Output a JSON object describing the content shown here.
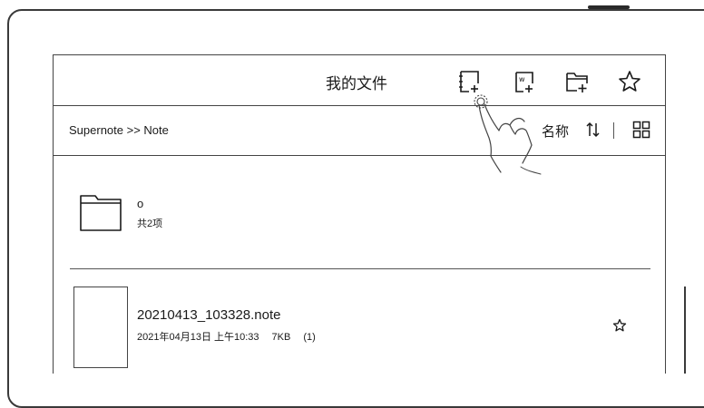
{
  "header": {
    "title": "我的文件",
    "actions": [
      {
        "name": "new-note",
        "icon": "new-note-icon"
      },
      {
        "name": "new-document",
        "icon": "new-document-icon"
      },
      {
        "name": "new-folder",
        "icon": "new-folder-icon"
      },
      {
        "name": "favorites",
        "icon": "star-icon"
      }
    ]
  },
  "path_bar": {
    "breadcrumb": "Supernote >> Note",
    "sort_label": "名称",
    "sort_icon": "sort-arrows-icon",
    "view_icon": "grid-view-icon"
  },
  "items": {
    "folder": {
      "name": "o",
      "count": "共2项",
      "icon": "folder-icon"
    },
    "file": {
      "name": "20210413_103328.note",
      "date": "2021年04月13日 上午10:33",
      "size": "7KB",
      "pages": "(1)",
      "fav_icon": "star-outline-icon"
    }
  }
}
